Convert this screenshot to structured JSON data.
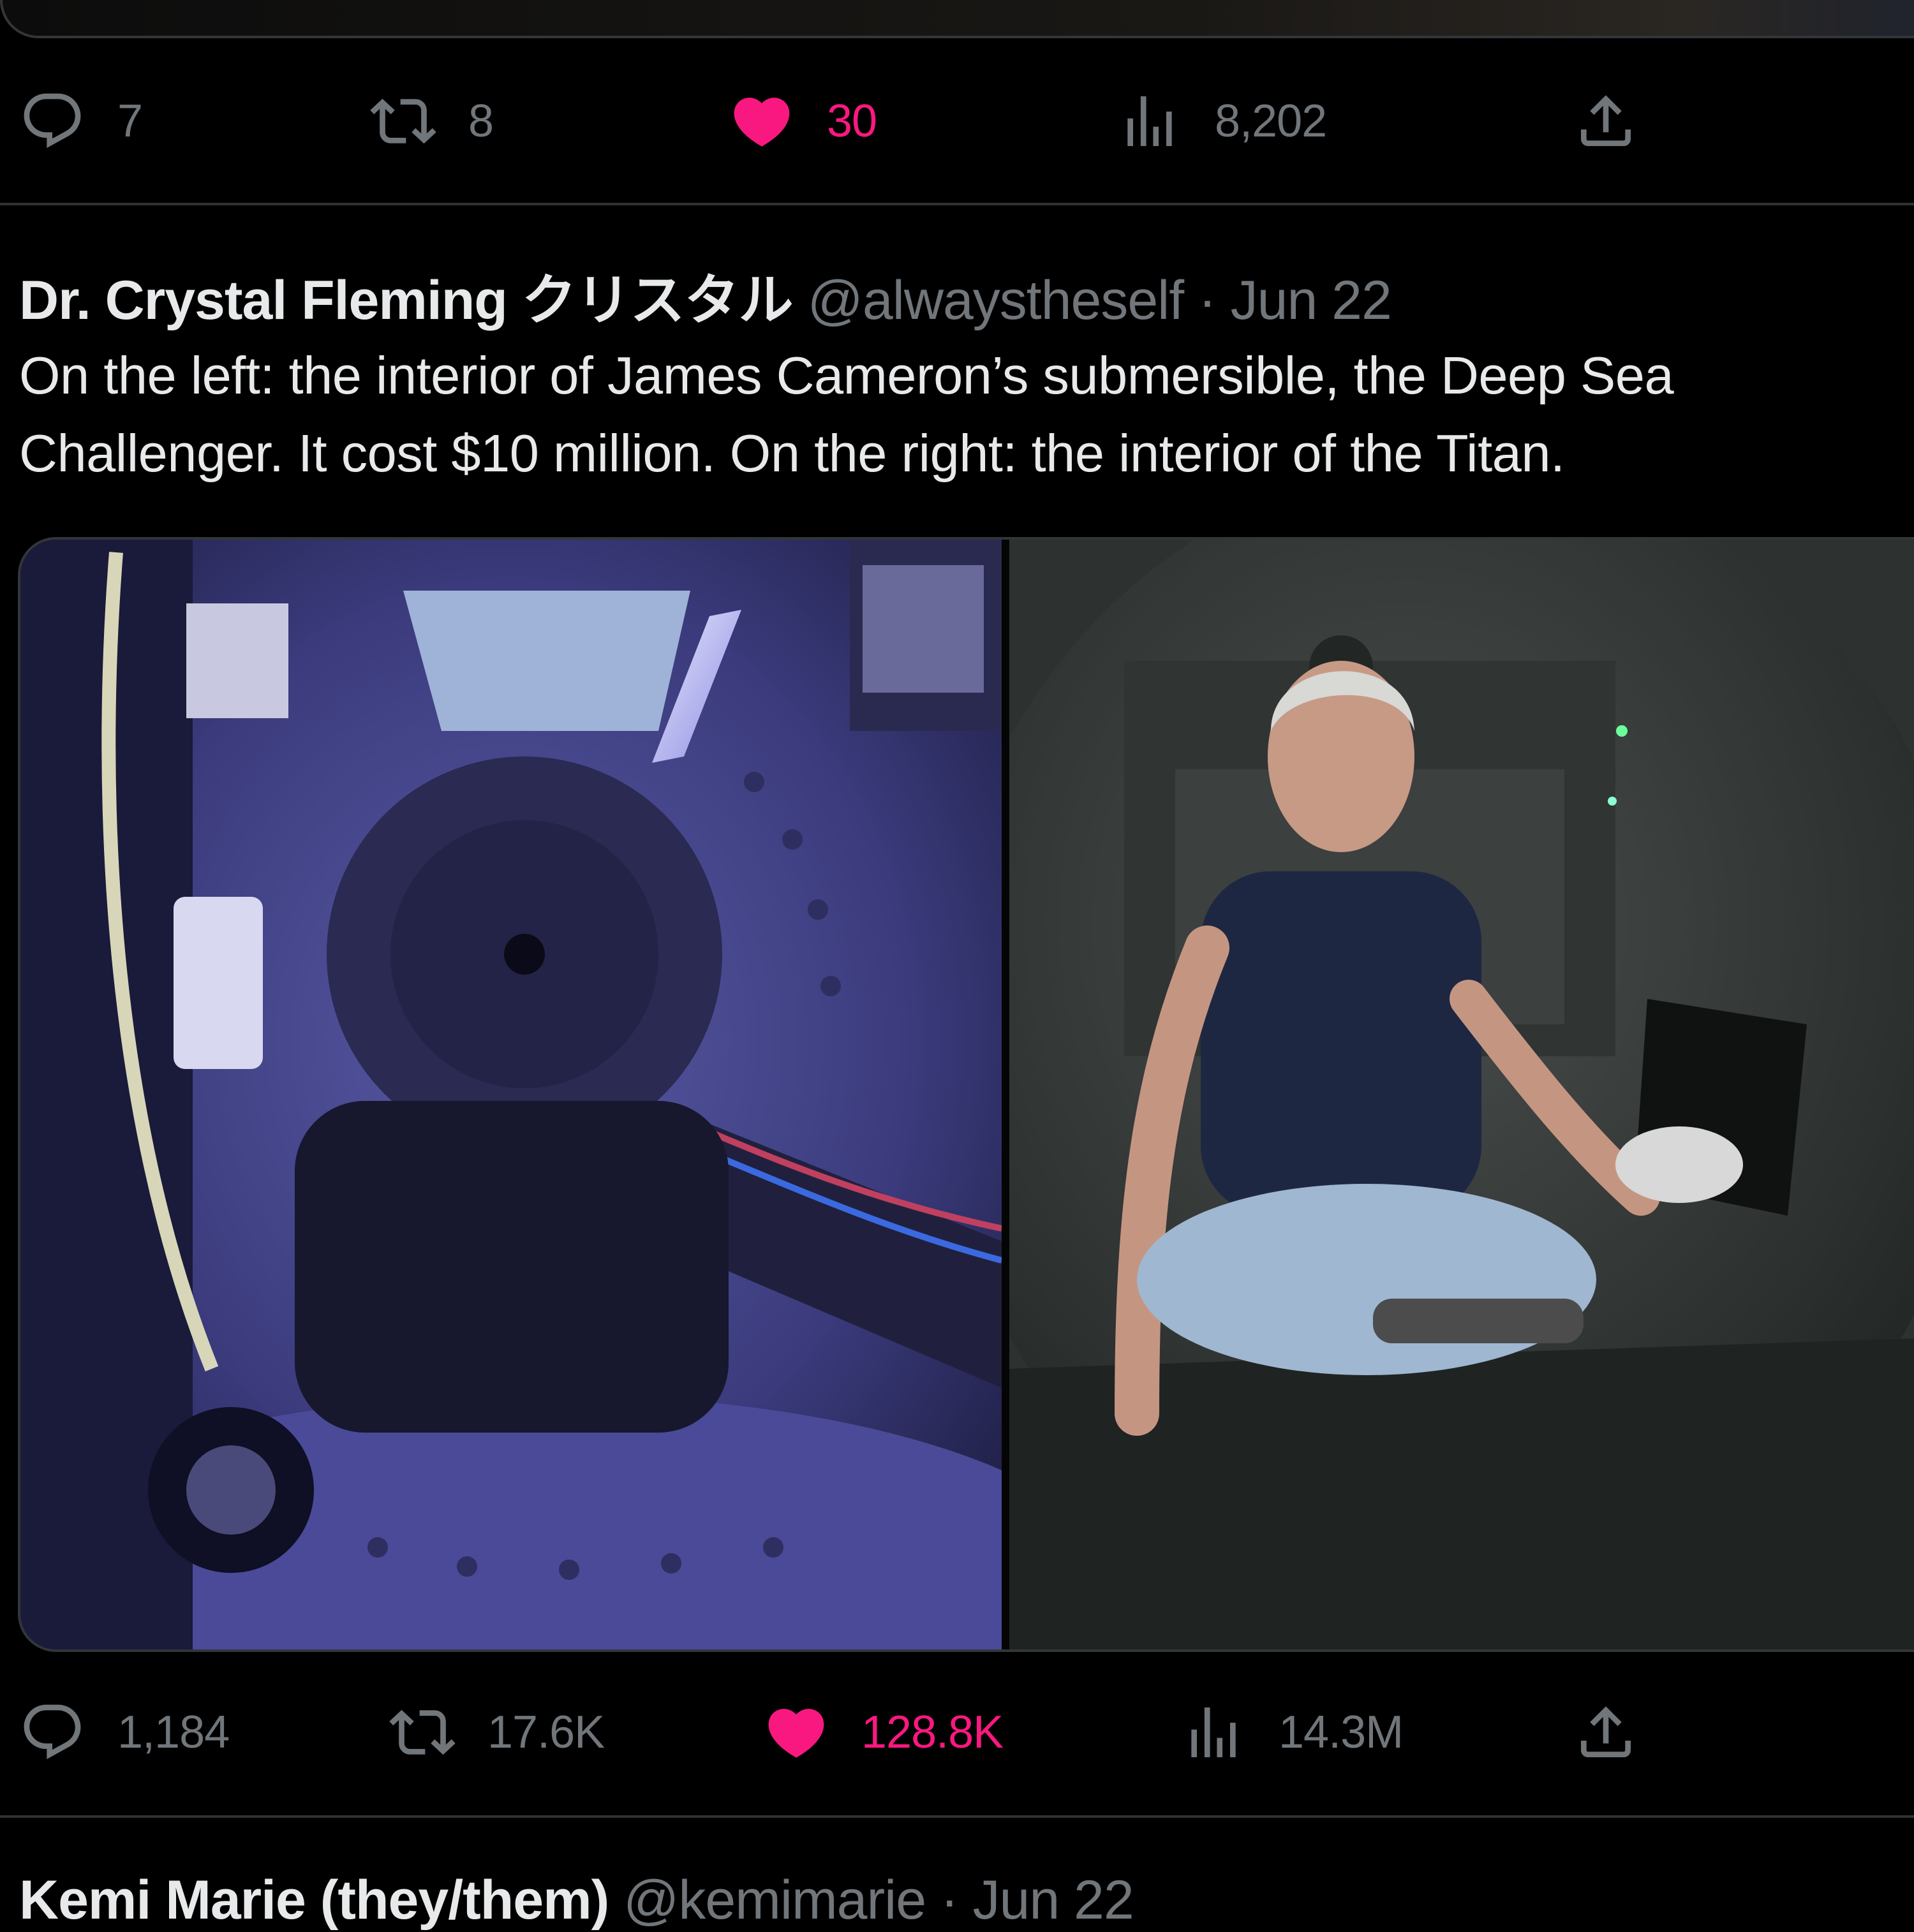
{
  "prev_tweet": {
    "actions": {
      "replies": "7",
      "retweets": "8",
      "likes": "30",
      "views": "8,202"
    }
  },
  "tweet": {
    "author_name": "Dr. Crystal Fleming クリスタル",
    "handle": "@alwaystheself",
    "separator": "·",
    "date": "Jun 22",
    "text": "On the left: the interior of James Cameron’s submersible, the Deep Sea Challenger. It cost $10 million. On the right: the interior of the Titan.",
    "actions": {
      "replies": "1,184",
      "retweets": "17.6K",
      "likes": "128.8K",
      "views": "14.3M"
    }
  },
  "next_tweet": {
    "author_name": "Kemi Marie (they/them)",
    "handle": "@kemimarie",
    "separator": "·",
    "date": "Jun 22"
  },
  "icons": {
    "reply": "reply-icon",
    "retweet": "retweet-icon",
    "like": "heart-icon",
    "views": "views-icon",
    "share": "share-icon"
  },
  "colors": {
    "background": "#000000",
    "text_primary": "#e7e9ea",
    "text_secondary": "#71767b",
    "like_active": "#f91880",
    "divider": "#2f3336"
  }
}
